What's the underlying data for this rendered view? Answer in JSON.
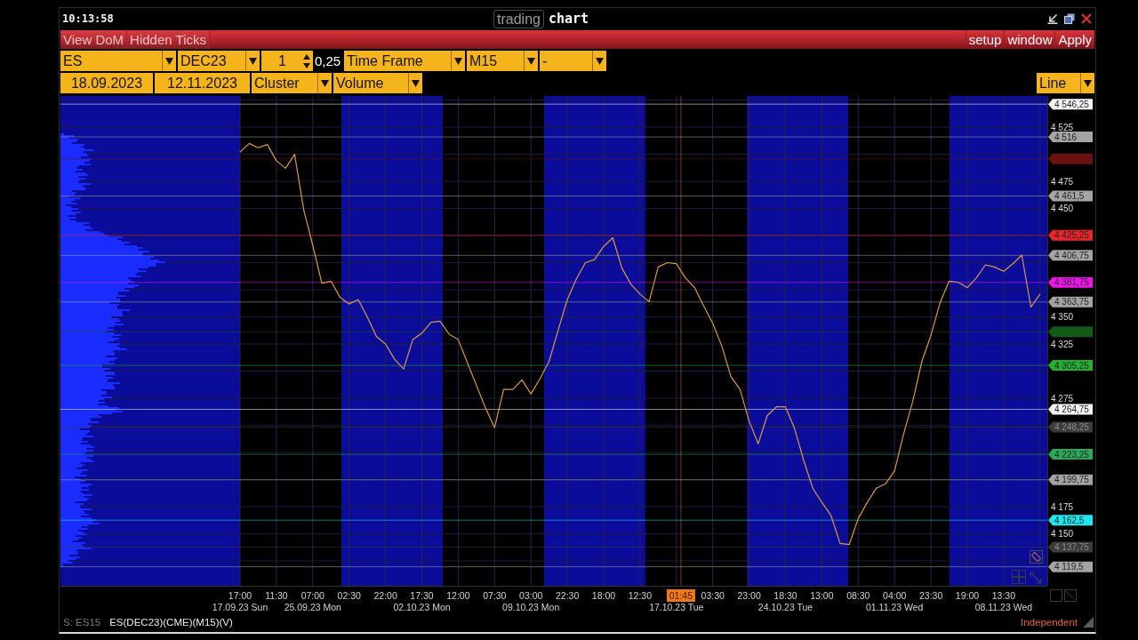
{
  "title_bar": {
    "clock": "10:13:58",
    "app_name_boxed": "trading",
    "app_name": "chart"
  },
  "menu_bar": {
    "left_items": [
      "View DoM",
      "Hidden Ticks"
    ],
    "right_items": [
      "setup",
      "window",
      "Apply"
    ]
  },
  "toolbar_row_1": [
    {
      "kind": "dropdown",
      "value": "ES"
    },
    {
      "kind": "dropdown",
      "value": "DEC23"
    },
    {
      "kind": "spinner",
      "value": "1"
    },
    {
      "kind": "readout",
      "value": "0,25"
    },
    {
      "kind": "dropdown",
      "value": "Time Frame"
    },
    {
      "kind": "dropdown",
      "value": "M15"
    },
    {
      "kind": "dropdown",
      "value": "-"
    }
  ],
  "toolbar_row_2": [
    {
      "kind": "date",
      "value": "18.09.2023"
    },
    {
      "kind": "date",
      "value": "12.11.2023"
    },
    {
      "kind": "dropdown",
      "value": "Cluster"
    },
    {
      "kind": "dropdown",
      "value": "Volume"
    }
  ],
  "chart_style": {
    "value": "Line"
  },
  "chart": {
    "chart_data": {
      "type": "line",
      "categories": [
        "17:00",
        null,
        null,
        null,
        "11:30",
        null,
        null,
        null,
        "07:00",
        null,
        null,
        null,
        "02:30",
        null,
        null,
        null,
        "22:00",
        null,
        null,
        null,
        "17:30",
        null,
        null,
        null,
        "12:00",
        null,
        null,
        null,
        "07:30",
        null,
        null,
        null,
        "03:00",
        null,
        null,
        null,
        "22:30",
        null,
        null,
        null,
        "18:00",
        null,
        null,
        null,
        "12:30",
        null,
        null,
        null,
        null,
        null,
        null,
        null,
        "03:30",
        null,
        null,
        null,
        "23:00",
        null,
        null,
        null,
        "18:30",
        null,
        null,
        null,
        "13:00",
        null,
        null,
        null,
        "08:30",
        null,
        null,
        null,
        "04:00",
        null,
        null,
        null,
        "23:30",
        null,
        null,
        null,
        "19:00",
        null,
        null,
        null,
        "13:30",
        null,
        null,
        null,
        null
      ],
      "series": [
        {
          "color": "#d99a45",
          "values": [
            4502,
            4510,
            4506,
            4509,
            4494,
            4487,
            4500,
            4449,
            4416,
            4381,
            4383,
            4368,
            4362,
            4366,
            4350,
            4332,
            4325,
            4311,
            4302,
            4329,
            4335,
            4345,
            4346,
            4334,
            4329,
            4308,
            4287,
            4266,
            4248,
            4283,
            4283,
            4292,
            4279,
            4293,
            4309,
            4338,
            4366,
            4385,
            4400,
            4403,
            4415,
            4423,
            4395,
            4380,
            4371,
            4364,
            4396,
            4400,
            4399,
            4386,
            4377,
            4360,
            4344,
            4323,
            4295,
            4283,
            4254,
            4233,
            4259,
            4267,
            4267,
            4247,
            4218,
            4192,
            4179,
            4167,
            4141,
            4140,
            4164,
            4179,
            4192,
            4196,
            4208,
            4242,
            4272,
            4309,
            4333,
            4363,
            4383,
            4382,
            4377,
            4386,
            4398,
            4396,
            4392,
            4399,
            4407,
            4359,
            4371
          ]
        }
      ],
      "ylim": [
        4102,
        4553.75
      ],
      "yticks": [
        {
          "value": 4525,
          "label": "4 525"
        },
        {
          "value": 4475,
          "label": "4 475"
        },
        {
          "value": 4450,
          "label": "4 450"
        },
        {
          "value": 4350,
          "label": "4 350"
        },
        {
          "value": 4325,
          "label": "4 325"
        },
        {
          "value": 4275,
          "label": "4 275"
        },
        {
          "value": 4175,
          "label": "4 175"
        },
        {
          "value": 4150,
          "label": "4 150"
        }
      ],
      "grid": true,
      "ref_lines": [
        {
          "axis": "y",
          "value": 4546.25,
          "label": "4 546,25",
          "color": "#f4f4f4"
        },
        {
          "axis": "y",
          "value": 4516,
          "label": "4 516",
          "color": "#a4a4a4"
        },
        {
          "axis": "y",
          "value": 4495.75,
          "color": "#6a1212"
        },
        {
          "axis": "y",
          "value": 4461.5,
          "label": "4 461,5",
          "color": "#a4a4a4"
        },
        {
          "axis": "y",
          "value": 4425.25,
          "label": "4 425,25",
          "color": "#e8242a"
        },
        {
          "axis": "y",
          "value": 4406.75,
          "label": "4 406,75",
          "color": "#a4a4a4"
        },
        {
          "axis": "y",
          "value": 4381.75,
          "label": "4 381,75",
          "color": "#ee14ee"
        },
        {
          "axis": "y",
          "value": 4363.75,
          "label": "4 363,75",
          "color": "#a4a4a4"
        },
        {
          "axis": "y",
          "value": 4336.25,
          "color": "#135a16"
        },
        {
          "axis": "y",
          "value": 4305.25,
          "label": "4 305,25",
          "color": "#22b02e"
        },
        {
          "axis": "y",
          "value": 4264.75,
          "label": "4 264,75",
          "color": "#f4f4f4"
        },
        {
          "axis": "y",
          "value": 4248.25,
          "label": "4 248,25",
          "color": "#3c3c3c"
        },
        {
          "axis": "y",
          "value": 4223.25,
          "label": "4 223,25",
          "color": "#2aa85c"
        },
        {
          "axis": "y",
          "value": 4199.75,
          "label": "4 199,75",
          "color": "#a4a4a4"
        },
        {
          "axis": "y",
          "value": 4162.5,
          "label": "4 162,5",
          "color": "#1ee6f0"
        },
        {
          "axis": "y",
          "value": 4137.75,
          "label": "4 137,75",
          "color": "#3c3c3c"
        },
        {
          "axis": "y",
          "value": 4119.5,
          "label": "4 119,5",
          "color": "#a4a4a4"
        }
      ]
    },
    "crosshair": {
      "label": "01:45",
      "color": "#f07818"
    },
    "day_labels": [
      "17.09.23 Sun",
      "25.09.23 Mon",
      "02.10.23 Mon",
      "09.10.23 Mon",
      "17.10.23 Tue",
      "24.10.23 Tue",
      "01.11.23 Wed",
      "08.11.23 Wed"
    ]
  },
  "status_bar": {
    "code": "S: ES15",
    "instrument": "ES(DEC23)(CME)(M15)(V)",
    "mode": "Independent"
  }
}
